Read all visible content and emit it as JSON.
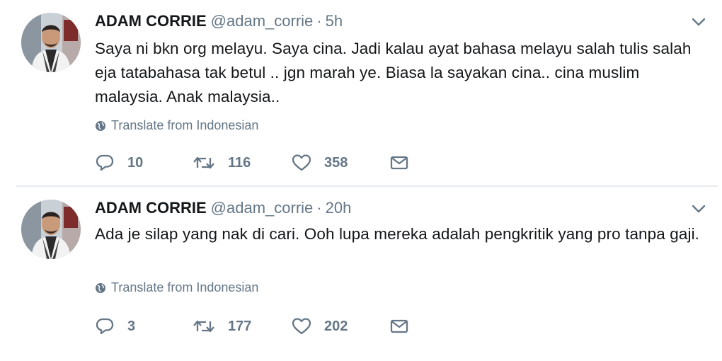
{
  "tweets": [
    {
      "author_name": "ADAM CORRIE",
      "handle": "@adam_corrie",
      "separator": "·",
      "time": "5h",
      "text": "Saya ni bkn org melayu. Saya cina. Jadi kalau ayat bahasa melayu salah tulis salah eja tatabahasa tak betul .. jgn marah ye. Biasa la sayakan cina.. cina muslim malaysia. Anak malaysia..",
      "translate_label": "Translate from Indonesian",
      "replies": "10",
      "retweets": "116",
      "likes": "358"
    },
    {
      "author_name": "ADAM CORRIE",
      "handle": "@adam_corrie",
      "separator": "·",
      "time": "20h",
      "text": "Ada je silap yang nak di cari. Ooh lupa mereka adalah pengkritik yang pro tanpa gaji.",
      "translate_label": "Translate from Indonesian",
      "replies": "3",
      "retweets": "177",
      "likes": "202"
    }
  ],
  "icons": {
    "reply": "reply-icon",
    "retweet": "retweet-icon",
    "like": "heart-icon",
    "dm": "envelope-icon",
    "translate": "globe-icon",
    "menu": "chevron-down-icon"
  },
  "colors": {
    "text": "#14171a",
    "secondary": "#657786",
    "divider": "#e6ecf0"
  }
}
